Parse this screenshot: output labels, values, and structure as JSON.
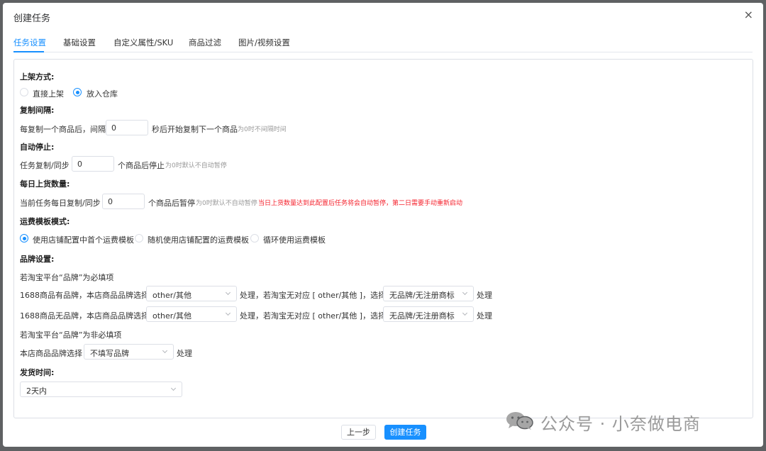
{
  "dialog": {
    "title": "创建任务",
    "close_icon": "×"
  },
  "tabs": [
    {
      "label": "任务设置",
      "active": true
    },
    {
      "label": "基础设置",
      "active": false
    },
    {
      "label": "自定义属性/SKU",
      "active": false
    },
    {
      "label": "商品过滤",
      "active": false
    },
    {
      "label": "图片/视频设置",
      "active": false
    }
  ],
  "listing": {
    "title": "上架方式:",
    "options": [
      {
        "label": "直接上架",
        "checked": false
      },
      {
        "label": "放入仓库",
        "checked": true
      }
    ]
  },
  "copy_interval": {
    "title": "复制间隔:",
    "prefix": "每复制一个商品后，间隔",
    "value": "0",
    "suffix": "秒后开始复制下一个商品",
    "hint": "为0时不间隔时间"
  },
  "auto_stop": {
    "title": "自动停止:",
    "prefix": "任务复制/同步",
    "value": "0",
    "suffix": "个商品后停止",
    "hint": "为0时默认不自动暂停"
  },
  "daily_limit": {
    "title": "每日上货数量:",
    "prefix": "当前任务每日复制/同步",
    "value": "0",
    "suffix": "个商品后暂停",
    "hint": "为0时默认不自动暂停",
    "warning": "当日上货数量达到此配置后任务将会自动暂停，第二日需要手动重新启动"
  },
  "freight": {
    "title": "运费模板模式:",
    "options": [
      {
        "label": "使用店铺配置中首个运费模板",
        "checked": true
      },
      {
        "label": "随机使用店铺配置的运费模板",
        "checked": false
      },
      {
        "label": "循环使用运费模板",
        "checked": false
      }
    ]
  },
  "brand": {
    "title": "品牌设置:",
    "required_note": "若淘宝平台“品牌”为必填项",
    "row1": {
      "prefix": "1688商品有品牌，本店商品品牌选择",
      "select1": "other/其他",
      "middle": "处理，若淘宝无对应 [ other/其他 ]，选择",
      "select2": "无品牌/无注册商标",
      "suffix": "处理"
    },
    "row2": {
      "prefix": "1688商品无品牌，本店商品品牌选择",
      "select1": "other/其他",
      "middle": "处理，若淘宝无对应 [ other/其他 ]，选择",
      "select2": "无品牌/无注册商标",
      "suffix": "处理"
    },
    "optional_note": "若淘宝平台“品牌”为非必填项",
    "row3": {
      "prefix": "本店商品品牌选择",
      "select": "不填写品牌",
      "suffix": "处理"
    }
  },
  "shipping": {
    "title": "发货时间:",
    "select": "2天内"
  },
  "footer": {
    "prev_label": "上一步",
    "create_label": "创建任务"
  },
  "watermark": {
    "text": "公众号 · 小奈做电商"
  },
  "colors": {
    "accent": "#1890ff",
    "warning": "#f5222d",
    "hint": "#999999"
  }
}
